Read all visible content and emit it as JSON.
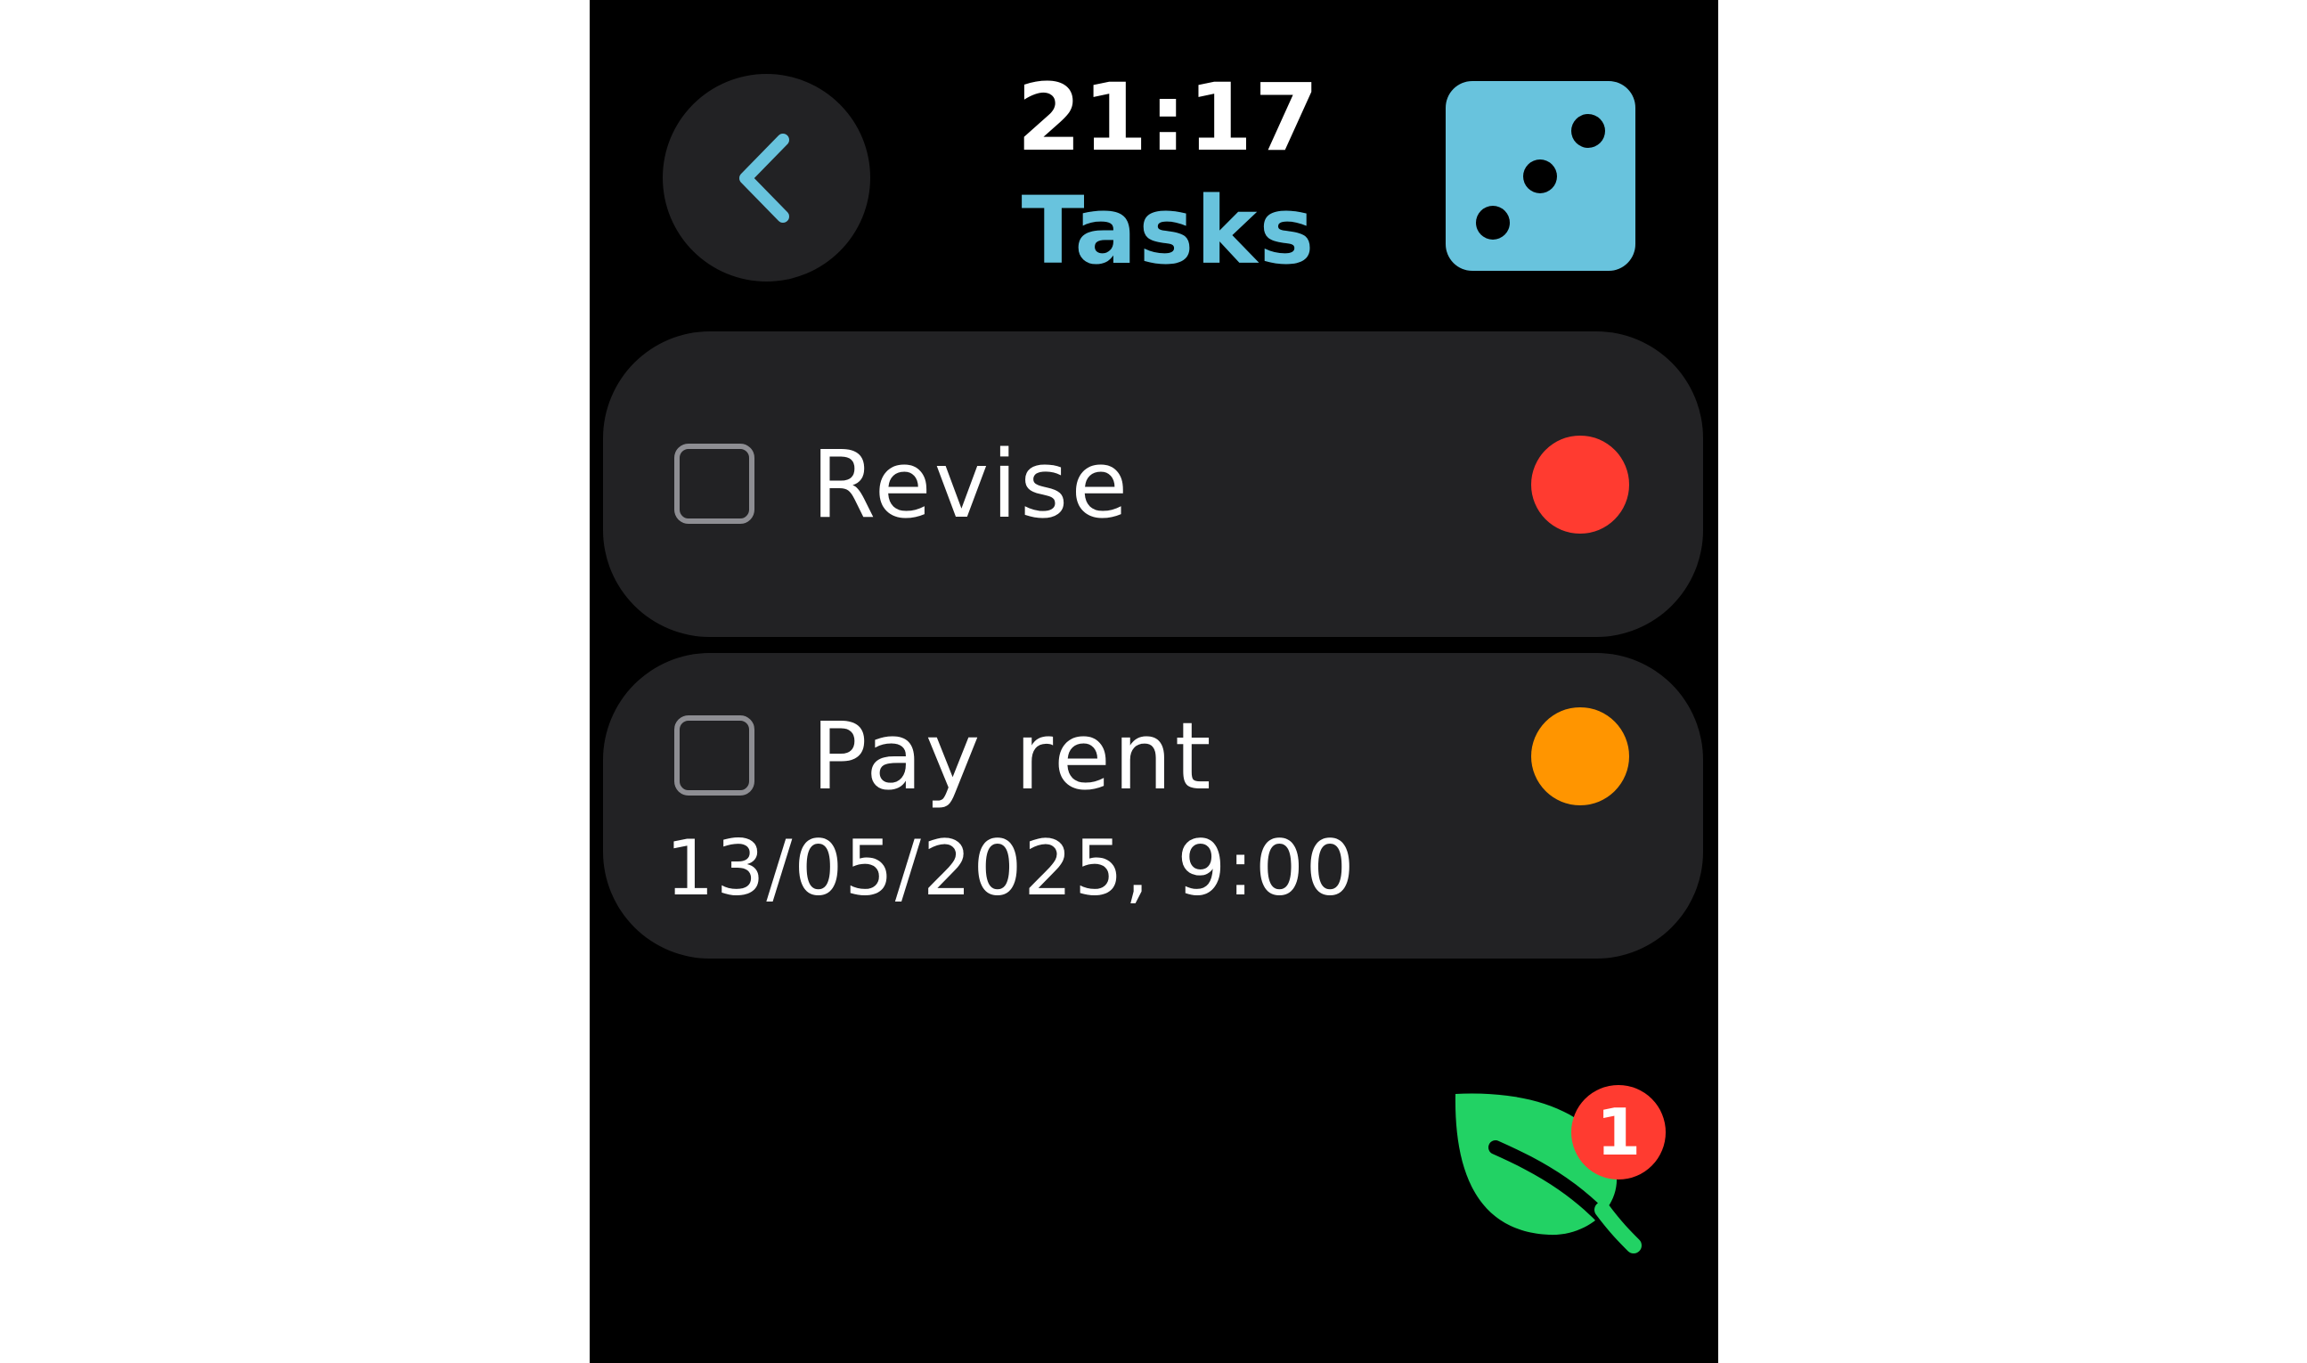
{
  "header": {
    "time": "21:17",
    "title": "Tasks",
    "back_icon": "chevron-left-icon",
    "dice_icon": "dice-three-icon"
  },
  "tasks": [
    {
      "title": "Revise",
      "due": "",
      "completed": false,
      "priority_color": "#ff3b30"
    },
    {
      "title": "Pay rent",
      "due": "13/05/2025, 9:00",
      "completed": false,
      "priority_color": "#ff9500"
    }
  ],
  "footer": {
    "leaf_icon": "leaf-icon",
    "badge_count": "1"
  },
  "colors": {
    "accent": "#68c3dd",
    "card_background": "#222224",
    "leaf": "#22d264",
    "badge": "#ff3b30",
    "priority_high": "#ff3b30",
    "priority_medium": "#ff9500"
  }
}
